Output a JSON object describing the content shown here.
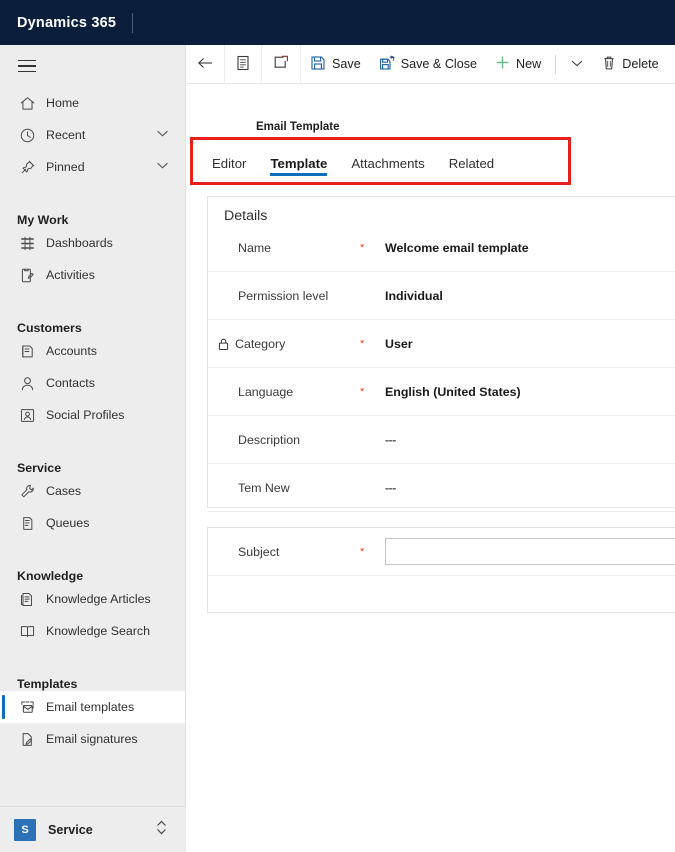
{
  "brand": {
    "title": "Dynamics 365"
  },
  "sidebar": {
    "hamburger_icon": "hamburger-icon",
    "items": [
      {
        "label": "Home",
        "icon": "home-icon",
        "type": "item",
        "chevron": false
      },
      {
        "label": "Recent",
        "icon": "clock-icon",
        "type": "item",
        "chevron": true
      },
      {
        "label": "Pinned",
        "icon": "pin-icon",
        "type": "item",
        "chevron": true
      },
      {
        "label": "My Work",
        "icon": "",
        "type": "group",
        "chevron": false
      },
      {
        "label": "Dashboards",
        "icon": "dashboard-icon",
        "type": "item",
        "chevron": false
      },
      {
        "label": "Activities",
        "icon": "activities-icon",
        "type": "item",
        "chevron": false
      },
      {
        "label": "Customers",
        "icon": "",
        "type": "group",
        "chevron": false
      },
      {
        "label": "Accounts",
        "icon": "accounts-icon",
        "type": "item",
        "chevron": false
      },
      {
        "label": "Contacts",
        "icon": "contact-person-icon",
        "type": "item",
        "chevron": false
      },
      {
        "label": "Social Profiles",
        "icon": "social-profile-icon",
        "type": "item",
        "chevron": false
      },
      {
        "label": "Service",
        "icon": "",
        "type": "group",
        "chevron": false
      },
      {
        "label": "Cases",
        "icon": "wrench-icon",
        "type": "item",
        "chevron": false
      },
      {
        "label": "Queues",
        "icon": "queue-icon",
        "type": "item",
        "chevron": false
      },
      {
        "label": "Knowledge",
        "icon": "",
        "type": "group",
        "chevron": false
      },
      {
        "label": "Knowledge Articles",
        "icon": "article-icon",
        "type": "item",
        "chevron": false
      },
      {
        "label": "Knowledge Search",
        "icon": "book-icon",
        "type": "item",
        "chevron": false
      },
      {
        "label": "Templates",
        "icon": "",
        "type": "group",
        "chevron": false
      },
      {
        "label": "Email templates",
        "icon": "email-template-icon",
        "type": "item",
        "chevron": false,
        "selected": true
      },
      {
        "label": "Email signatures",
        "icon": "signature-icon",
        "type": "item",
        "chevron": false
      }
    ],
    "footer": {
      "badge": "S",
      "app_name": "Service",
      "switch_icon": "app-switcher-icon"
    }
  },
  "commandbar": {
    "back_icon": "back-arrow-icon",
    "form_icon": "form-icon",
    "popout_icon": "pop-out-icon",
    "save_label": "Save",
    "save_icon": "save-floppy-icon",
    "save_close_label": "Save & Close",
    "save_close_icon": "save-and-close-icon",
    "new_label": "New",
    "new_icon": "plus-icon",
    "overflow_icon": "chevron-down-icon",
    "delete_label": "Delete",
    "delete_icon": "trash-icon"
  },
  "record": {
    "entity_label": "Email Template"
  },
  "tabs": [
    {
      "label": "Editor",
      "active": false
    },
    {
      "label": "Template",
      "active": true
    },
    {
      "label": "Attachments",
      "active": false
    },
    {
      "label": "Related",
      "active": false
    }
  ],
  "details_card": {
    "title": "Details",
    "fields": [
      {
        "label": "Name",
        "required": true,
        "value": "Welcome email template",
        "locked": false
      },
      {
        "label": "Permission level",
        "required": false,
        "value": "Individual",
        "locked": false
      },
      {
        "label": "Category",
        "required": true,
        "value": "User",
        "locked": true
      },
      {
        "label": "Language",
        "required": true,
        "value": "English (United States)",
        "locked": false
      },
      {
        "label": "Description",
        "required": false,
        "value": "---",
        "locked": false
      },
      {
        "label": "Tem New",
        "required": false,
        "value": "---",
        "locked": false
      }
    ]
  },
  "subject_card": {
    "label": "Subject",
    "required": true,
    "value": "",
    "placeholder": ""
  },
  "highlight": {
    "name": "tab-strip-highlight",
    "color": "#e8201b"
  },
  "colors": {
    "brand_bar": "#0b1f3d",
    "accent": "#0f6cbd",
    "required_asterisk": "#e8411b",
    "sidebar_bg": "#ededed",
    "highlight_red": "#e8201b",
    "new_green": "#6bb98a"
  }
}
